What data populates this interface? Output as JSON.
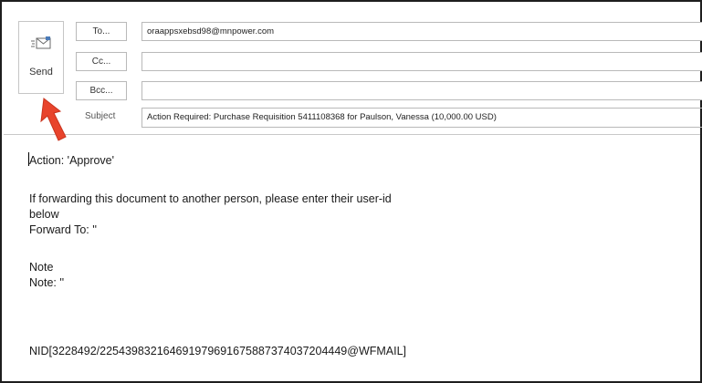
{
  "compose": {
    "send_label": "Send",
    "to_label": "To...",
    "cc_label": "Cc...",
    "bcc_label": "Bcc...",
    "subject_label": "Subject",
    "to_value": "oraappsxebsd98@mnpower.com",
    "cc_value": "",
    "bcc_value": "",
    "subject_value": "Action Required: Purchase Requisition 5411108368 for Paulson, Vanessa (10,000.00 USD)"
  },
  "message_body": {
    "line1": "Action: 'Approve'",
    "line2": "If forwarding this document to another person, please enter their user-id",
    "line3": "below",
    "line4": "Forward To: ''",
    "line5": "Note",
    "line6": "Note: ''",
    "line7": "NID[3228492/225439832164691979691675887374037204449@WFMAIL]"
  },
  "colors": {
    "annotation_arrow": "#e8442c",
    "send_icon": "#4a7ab8"
  },
  "icons": {
    "send": "envelope-send-icon",
    "annotation": "red-arrow-icon"
  }
}
